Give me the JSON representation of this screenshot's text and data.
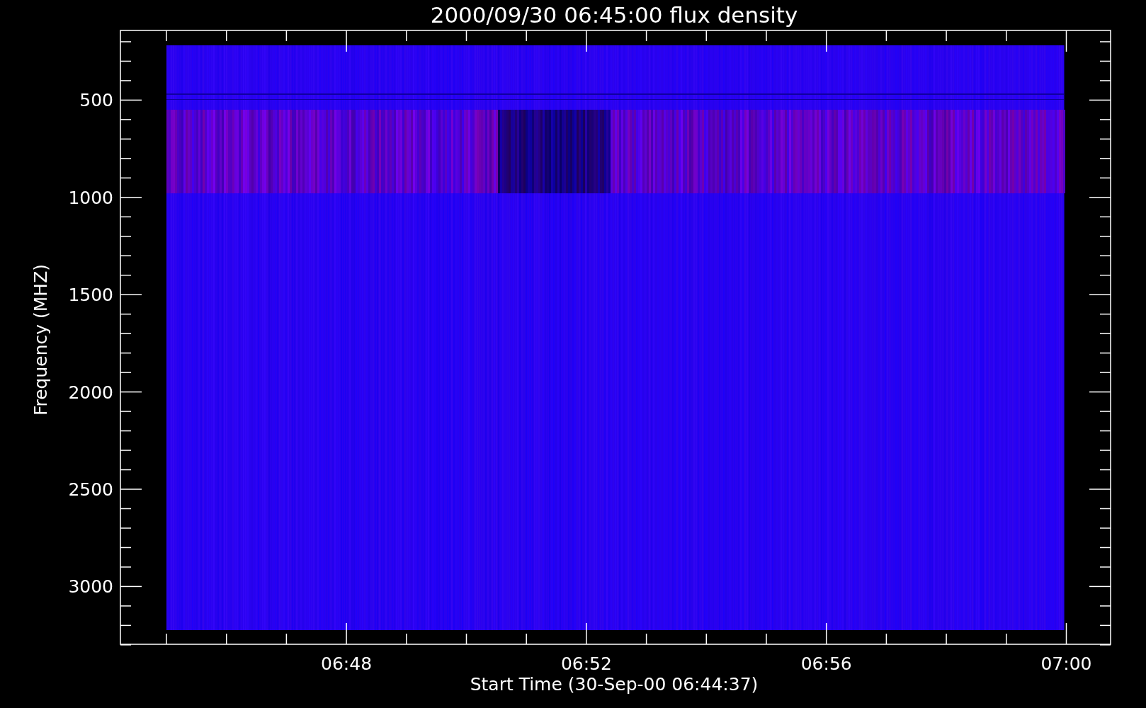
{
  "title": "2000/09/30 06:45:00 flux density",
  "ylabel": "Frequency (MHZ)",
  "xlabel": "Start Time (30-Sep-00 06:44:37)",
  "yticks": [
    "500",
    "1000",
    "1500",
    "2000",
    "2500",
    "3000"
  ],
  "xticks": [
    "06:48",
    "06:52",
    "06:56",
    "07:00"
  ]
}
